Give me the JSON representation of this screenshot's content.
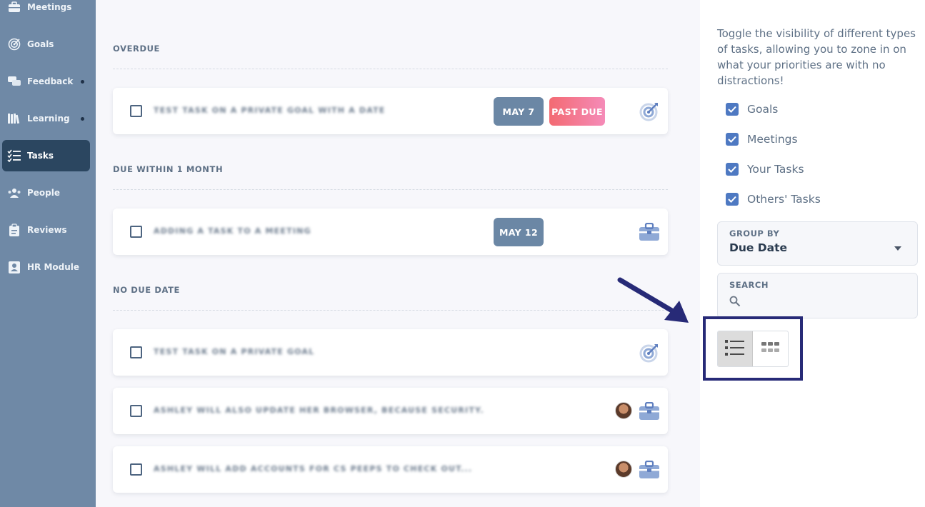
{
  "sidebar": {
    "items": [
      {
        "label": "Meetings",
        "icon": "briefcase-icon",
        "dot": false,
        "active": false
      },
      {
        "label": "Goals",
        "icon": "target-icon",
        "dot": false,
        "active": false
      },
      {
        "label": "Feedback",
        "icon": "chat-bubbles-icon",
        "dot": true,
        "active": false
      },
      {
        "label": "Learning",
        "icon": "books-icon",
        "dot": true,
        "active": false
      },
      {
        "label": "Tasks",
        "icon": "checklist-icon",
        "dot": false,
        "active": true
      },
      {
        "label": "People",
        "icon": "people-icon",
        "dot": false,
        "active": false
      },
      {
        "label": "Reviews",
        "icon": "clipboard-icon",
        "dot": false,
        "active": false
      },
      {
        "label": "HR Module",
        "icon": "id-badge-icon",
        "dot": false,
        "active": false
      }
    ]
  },
  "main": {
    "sections": [
      {
        "title": "OVERDUE"
      },
      {
        "title": "DUE WITHIN 1 MONTH"
      },
      {
        "title": "NO DUE DATE"
      }
    ],
    "tasks": [
      {
        "title": "Test task on a private goal with a date",
        "date": "MAY 7",
        "status": "PAST DUE",
        "type_icon": "target-icon"
      },
      {
        "title": "Adding a task to a meeting",
        "date": "MAY 12",
        "type_icon": "briefcase-icon"
      },
      {
        "title": "Test task on a private goal",
        "type_icon": "target-icon"
      },
      {
        "title": "Ashley will also update her browser, because security.",
        "avatar": "user-avatar",
        "type_icon": "briefcase-icon"
      },
      {
        "title": "Ashley will add accounts for CS peeps to check out...",
        "avatar": "user-avatar",
        "type_icon": "briefcase-icon"
      }
    ]
  },
  "panel": {
    "description": "Toggle the visibility of different types of tasks, allowing you to zone in on what your priorities are with no distractions!",
    "toggles": [
      {
        "label": "Goals",
        "checked": true
      },
      {
        "label": "Meetings",
        "checked": true
      },
      {
        "label": "Your Tasks",
        "checked": true
      },
      {
        "label": "Others' Tasks",
        "checked": true
      }
    ],
    "group_by": {
      "label": "GROUP BY",
      "value": "Due Date"
    },
    "search": {
      "label": "SEARCH",
      "value": ""
    },
    "view_toggle": {
      "selected": "list",
      "options": [
        "list-view-icon",
        "grid-view-icon"
      ]
    }
  },
  "colors": {
    "sidebar_bg": "#6f89a6",
    "sidebar_active": "#2b4660",
    "accent": "#4e79c2",
    "date_badge": "#6b87a5",
    "past_due_start": "#f36a72",
    "past_due_end": "#f58bb8",
    "annotation": "#272a77"
  }
}
